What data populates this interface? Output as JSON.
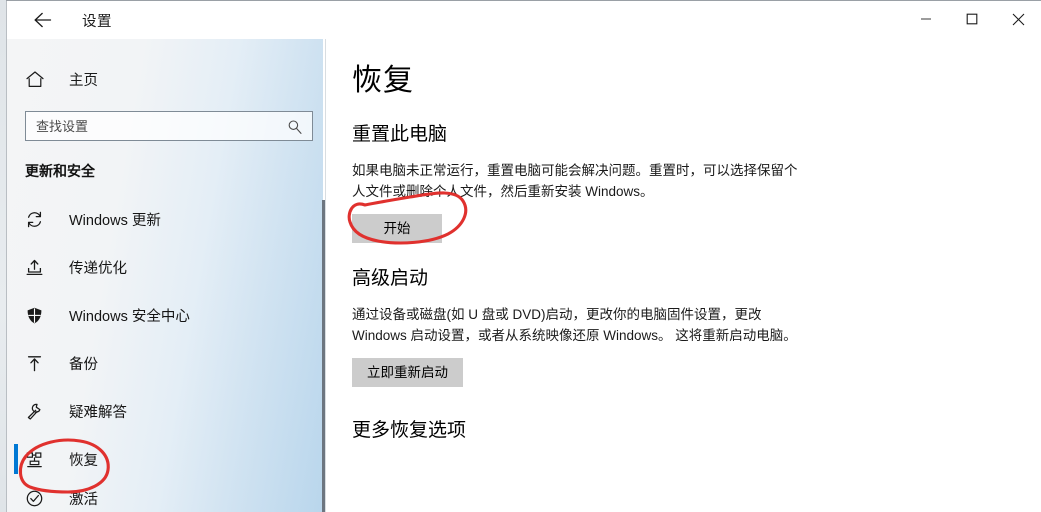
{
  "window": {
    "title": "设置",
    "back_icon": "back-arrow-icon",
    "controls": {
      "minimize": "minimize-icon",
      "maximize": "maximize-icon",
      "close": "close-icon"
    }
  },
  "sidebar": {
    "home": {
      "label": "主页",
      "icon": "home-icon"
    },
    "search": {
      "placeholder": "查找设置",
      "value": "",
      "icon": "search-icon"
    },
    "section_heading": "更新和安全",
    "items": [
      {
        "label": "Windows 更新",
        "icon": "sync-icon",
        "selected": false
      },
      {
        "label": "传递优化",
        "icon": "delivery-optimization-icon",
        "selected": false
      },
      {
        "label": "Windows 安全中心",
        "icon": "shield-icon",
        "selected": false
      },
      {
        "label": "备份",
        "icon": "backup-upload-icon",
        "selected": false
      },
      {
        "label": "疑难解答",
        "icon": "wrench-icon",
        "selected": false
      },
      {
        "label": "恢复",
        "icon": "recovery-icon",
        "selected": true
      },
      {
        "label": "激活",
        "icon": "activation-check-icon",
        "selected": false
      }
    ]
  },
  "main": {
    "page_title": "恢复",
    "sections": [
      {
        "title": "重置此电脑",
        "body": "如果电脑未正常运行，重置电脑可能会解决问题。重置时，可以选择保留个人文件或删除个人文件，然后重新安装 Windows。",
        "button": "开始"
      },
      {
        "title": "高级启动",
        "body": "通过设备或磁盘(如 U 盘或 DVD)启动，更改你的电脑固件设置，更改 Windows 启动设置，或者从系统映像还原 Windows。 这将重新启动电脑。",
        "button": "立即重新启动"
      },
      {
        "title": "更多恢复选项",
        "body": "",
        "button": ""
      }
    ]
  },
  "annotations": {
    "ink_color": "#e0312e",
    "marks": [
      {
        "name": "circle-around-start-button",
        "shape": "hand-drawn-oval"
      },
      {
        "name": "circle-around-recovery-nav-item",
        "shape": "hand-drawn-oval"
      }
    ]
  },
  "colors": {
    "accent": "#0078d4",
    "button_bg": "#cccccc",
    "sidebar_gradient_end": "#b9d6ec",
    "ink_red": "#e0312e"
  }
}
